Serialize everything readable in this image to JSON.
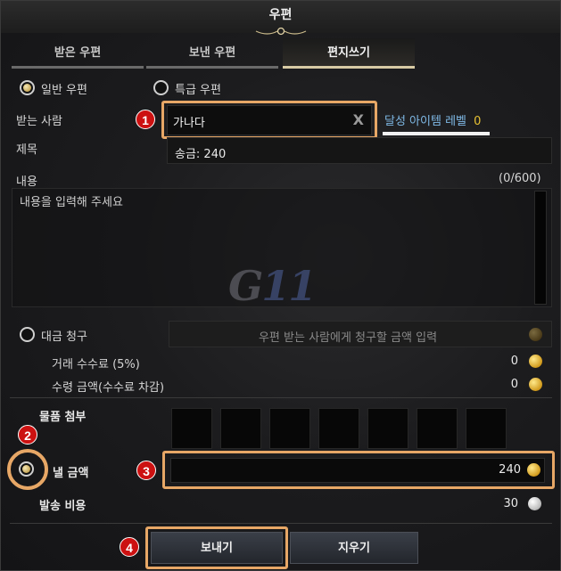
{
  "window": {
    "title": "우편"
  },
  "tabs": [
    {
      "label": "받은 우편",
      "active": false
    },
    {
      "label": "보낸 우편",
      "active": false
    },
    {
      "label": "편지쓰기",
      "active": true
    }
  ],
  "mail_type": {
    "normal_label": "일반 우편",
    "express_label": "특급 우편",
    "selected": "일반 우편"
  },
  "recipient": {
    "label": "받는 사람",
    "value": "가나다",
    "clear_glyph": "X",
    "achievement_label": "달성 아이템 레벨",
    "achievement_value": "0"
  },
  "subject": {
    "label": "제목",
    "value": "송금: 240"
  },
  "content": {
    "label": "내용",
    "counter": "(0/600)",
    "placeholder": "내용을 입력해 주세요"
  },
  "watermark": {
    "text": "G",
    "accent": "11"
  },
  "cod": {
    "label": "대금 청구",
    "placeholder": "우편 받는 사람에게 청구할 금액 입력",
    "fee_label": "거래 수수료 (5%)",
    "fee_value": "0",
    "receive_label": "수령 금액(수수료 차감)",
    "receive_value": "0"
  },
  "attachment": {
    "label": "물품 첨부",
    "slot_count": 7
  },
  "send_gold": {
    "label": "낼 금액",
    "value": "240"
  },
  "postage": {
    "label": "발송 비용",
    "value": "30"
  },
  "buttons": {
    "send": "보내기",
    "clear": "지우기"
  },
  "annotations": [
    "1",
    "2",
    "3",
    "4"
  ],
  "colors": {
    "highlight": "#e7a766",
    "badge": "#cc1111",
    "link": "#7fb9e6",
    "gold": "#e8b833"
  }
}
